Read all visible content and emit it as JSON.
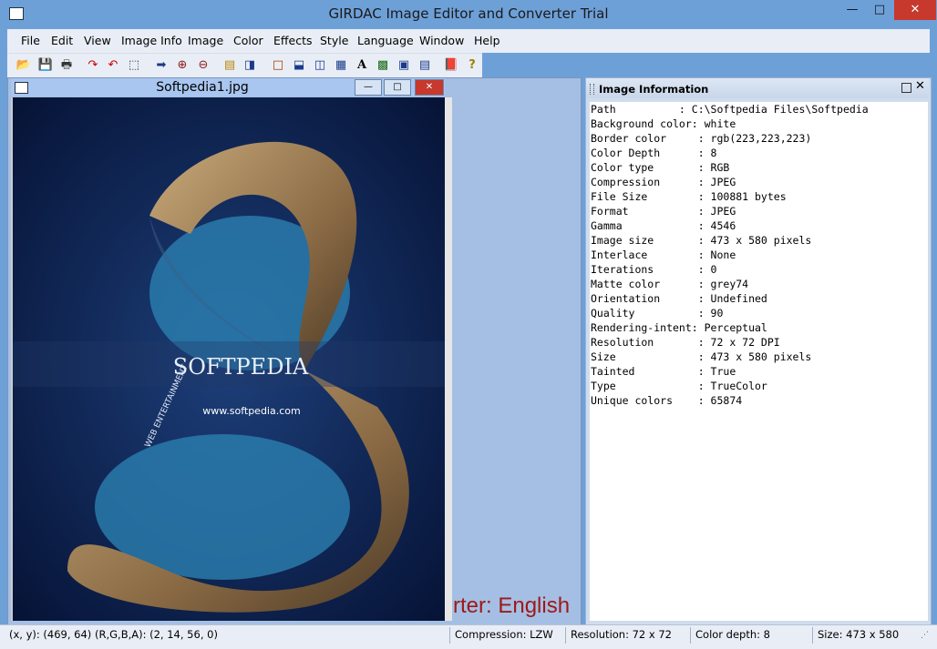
{
  "window": {
    "title": "GIRDAC Image Editor and Converter Trial",
    "minimize": "—",
    "maximize": "□",
    "close": "✕"
  },
  "menu": [
    "File",
    "Edit",
    "View",
    "Image Info",
    "Image",
    "Color",
    "Effects",
    "Style",
    "Language",
    "Window",
    "Help"
  ],
  "toolbar": {
    "icons": [
      "open-folder-icon",
      "save-icon",
      "print-icon",
      "redo-icon",
      "undo-icon",
      "select-icon",
      "arrow-right-icon",
      "zoom-in-icon",
      "zoom-out-icon",
      "crop-icon",
      "rotate-icon",
      "rectangle-icon",
      "split-horizontal-icon",
      "split-vertical-icon",
      "cascade-icon",
      "text-icon",
      "grid-icon",
      "window-a-icon",
      "window-b-icon",
      "book-icon",
      "help-icon"
    ],
    "glyphs": [
      "📂",
      "💾",
      "🖶",
      "↷",
      "↶",
      "⬚",
      "➡",
      "⊕",
      "⊖",
      "▤",
      "◨",
      "□",
      "⬓",
      "◫",
      "▦",
      "A",
      "▩",
      "▣",
      "▤",
      "📕",
      "?"
    ]
  },
  "document": {
    "name": "Softpedia1.jpg",
    "min": "—",
    "max": "□",
    "close": "✕",
    "watermark": "SOFTPEDIA",
    "url_text": "www.softpedia.com",
    "ribbon_text": "WEB  ENTERTAINMENT"
  },
  "background_text": "rter: English",
  "info": {
    "title": "Image Information",
    "rows": [
      "Path          : C:\\Softpedia Files\\Softpedia",
      "Background color: white",
      "Border color     : rgb(223,223,223)",
      "Color Depth      : 8",
      "Color type       : RGB",
      "Compression      : JPEG",
      "File Size        : 100881 bytes",
      "Format           : JPEG",
      "Gamma            : 4546",
      "Image size       : 473 x 580 pixels",
      "Interlace        : None",
      "Iterations       : 0",
      "Matte color      : grey74",
      "Orientation      : Undefined",
      "Quality          : 90",
      "Rendering-intent: Perceptual",
      "Resolution       : 72 x 72 DPI",
      "Size             : 473 x 580 pixels",
      "Tainted          : True",
      "Type             : TrueColor",
      "Unique colors    : 65874"
    ]
  },
  "status": {
    "xy": "(x, y): (469, 64)",
    "rgba": "(R,G,B,A): (2, 14, 56, 0)",
    "compression": "Compression: LZW",
    "resolution": "Resolution: 72 x 72",
    "color_depth": "Color depth: 8",
    "size": "Size: 473 x 580"
  },
  "colors": {
    "accent": "#6ea0d8",
    "close": "#c7382d",
    "bg_text": "#a01818"
  }
}
